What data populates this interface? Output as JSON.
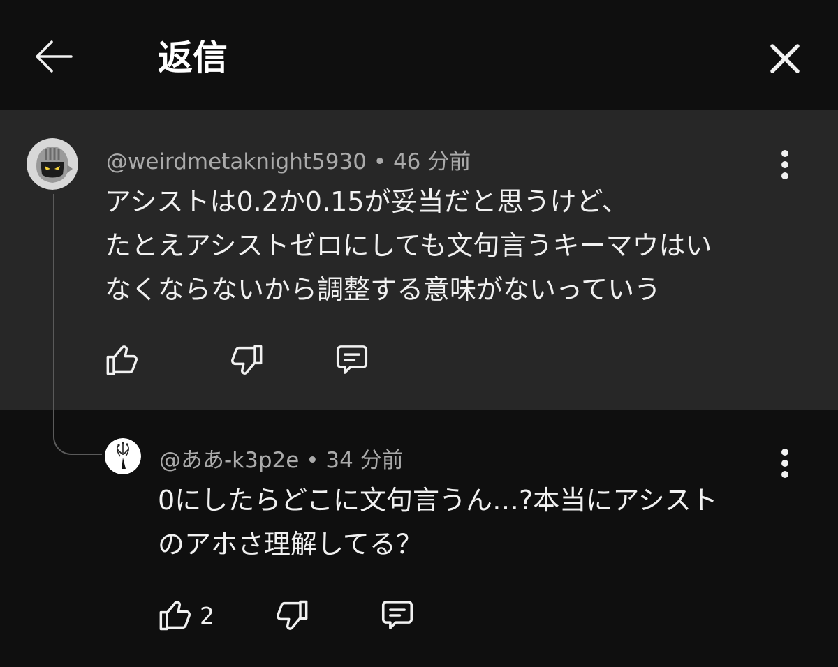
{
  "header": {
    "title": "返信",
    "back_icon": "arrow-left-icon",
    "close_icon": "close-icon"
  },
  "parent_comment": {
    "author": "@weirdmetaknight5930",
    "time": "46 分前",
    "lines": [
      "アシストは0.2か0.15が妥当だと思うけど、",
      "たとえアシストゼロにしても文句言うキーマウはい",
      "なくならないから調整する意味がないっていう"
    ],
    "avatar_icon": "metaknight-avatar-icon"
  },
  "reply_comment": {
    "author": "@ああ-k3p2e",
    "time": "34 分前",
    "lines": [
      "0にしたらどこに文句言うん…?本当にアシスト",
      "のアホさ理解してる？"
    ],
    "like_count": "2",
    "avatar_icon": "sketch-avatar-icon"
  },
  "separator": "•",
  "colors": {
    "background": "#0f0f0f",
    "highlight": "#272727",
    "secondary_text": "#aaaaaa",
    "primary_text": "#f1f1f1"
  }
}
